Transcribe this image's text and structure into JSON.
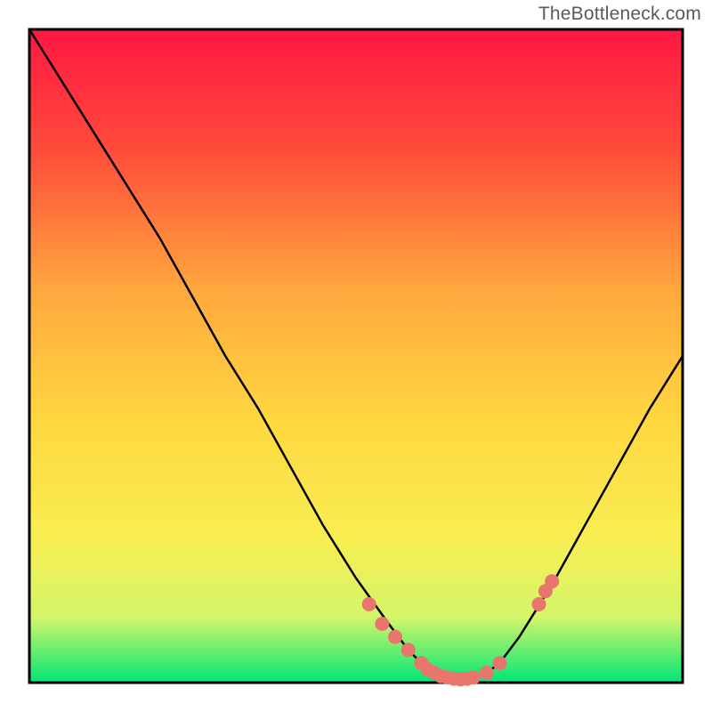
{
  "watermark": "TheBottleneck.com",
  "chart_data": {
    "type": "line",
    "title": "",
    "xlabel": "",
    "ylabel": "",
    "xlim": [
      0,
      100
    ],
    "ylim": [
      0,
      100
    ],
    "grid": false,
    "legend": false,
    "background_gradient": {
      "top_color": "#ff1744",
      "mid_color": "#ffd740",
      "bottom_color": "#00e676"
    },
    "curve": {
      "description": "Bottleneck V-curve showing optimal point near minimum",
      "x": [
        0,
        5,
        10,
        15,
        20,
        25,
        30,
        35,
        40,
        45,
        50,
        55,
        58,
        60,
        62,
        64,
        66,
        68,
        70,
        72,
        75,
        80,
        85,
        90,
        95,
        100
      ],
      "y": [
        100,
        92,
        84,
        76,
        68,
        59,
        50,
        42,
        33,
        24,
        16,
        9,
        5,
        3,
        1.5,
        0.8,
        0.5,
        0.8,
        1.5,
        3,
        7,
        15,
        24,
        33,
        42,
        50
      ]
    },
    "markers": {
      "description": "Highlighted optimal-range points (salmon dots)",
      "color": "#e8766d",
      "x": [
        52,
        54,
        56,
        58,
        60,
        61,
        62,
        63,
        64,
        65,
        66,
        67,
        68,
        70,
        72,
        78,
        79,
        80
      ],
      "y": [
        12,
        9,
        7,
        5,
        3,
        2,
        1.5,
        1,
        0.8,
        0.6,
        0.5,
        0.6,
        0.8,
        1.5,
        3,
        12,
        14,
        15.5
      ]
    }
  }
}
